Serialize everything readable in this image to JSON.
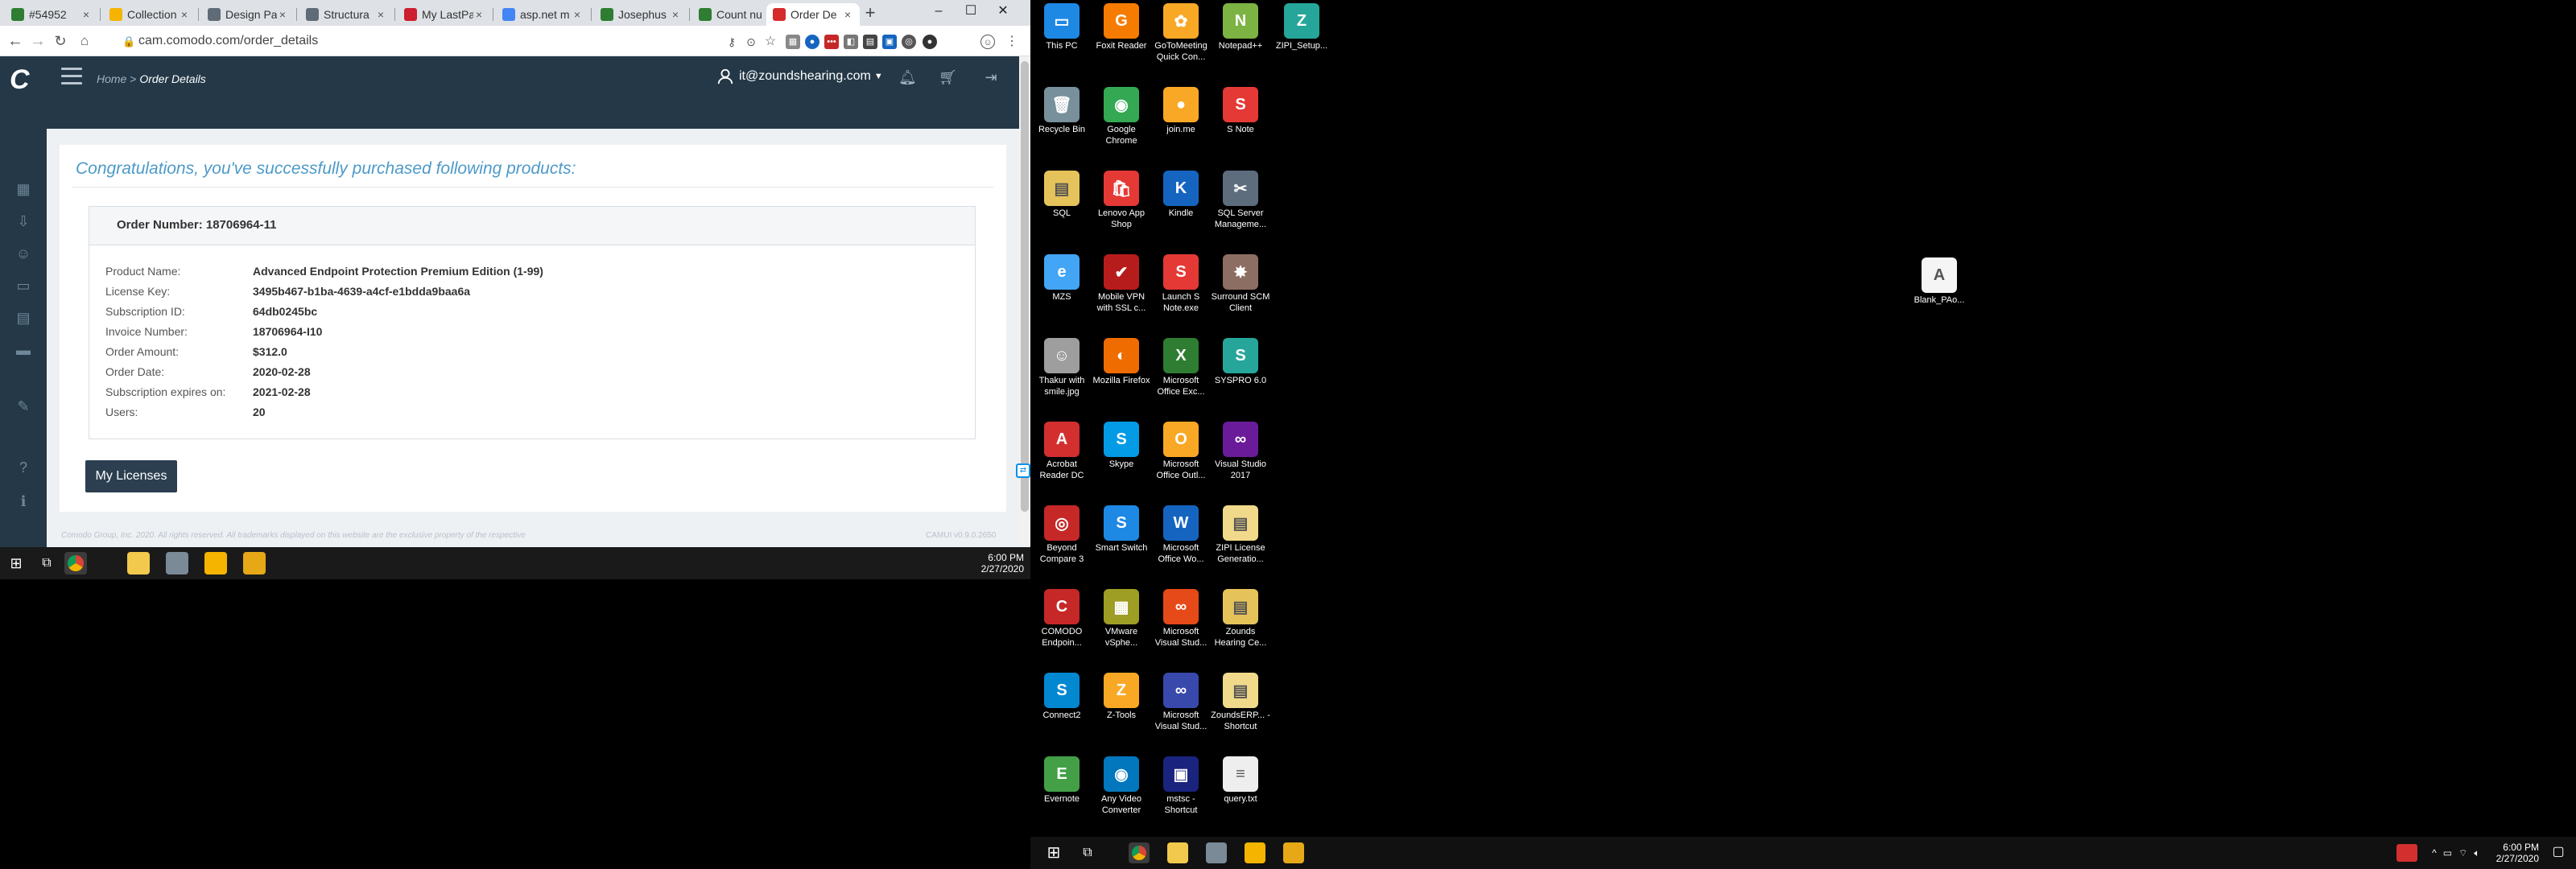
{
  "browser": {
    "tabs": [
      {
        "title": "#54952",
        "color": "#2e7d32"
      },
      {
        "title": "Collection",
        "color": "#f4b400"
      },
      {
        "title": "Design Pa",
        "color": "#5f6b76"
      },
      {
        "title": "Structura",
        "color": "#5f6b76"
      },
      {
        "title": "My LastPa",
        "color": "#cc1f2f"
      },
      {
        "title": "asp.net m",
        "color": "#4285f4"
      },
      {
        "title": "Josephus",
        "color": "#2e7d32"
      },
      {
        "title": "Count nu",
        "color": "#2e7d32"
      },
      {
        "title": "Order De",
        "color": "#d62b2b"
      }
    ],
    "url": "cam.comodo.com/order_details"
  },
  "app": {
    "logo": "C",
    "breadcrumb_home": "Home",
    "breadcrumb_sep": ">",
    "breadcrumb_current": "Order Details",
    "user_email": "it@zoundshearing.com"
  },
  "order": {
    "congrats": "Congratulations, you've successfully purchased following products:",
    "number_label": "Order Number:",
    "number": "18706964-11",
    "fields": [
      {
        "label": "Product Name:",
        "value": "Advanced Endpoint Protection Premium Edition (1-99)"
      },
      {
        "label": "License Key:",
        "value": "3495b467-b1ba-4639-a4cf-e1bdda9baa6a"
      },
      {
        "label": "Subscription ID:",
        "value": "64db0245bc"
      },
      {
        "label": "Invoice Number:",
        "value": "18706964-I10"
      },
      {
        "label": "Order Amount:",
        "value": "$312.0"
      },
      {
        "label": "Order Date:",
        "value": "2020-02-28"
      },
      {
        "label": "Subscription expires on:",
        "value": "2021-02-28"
      },
      {
        "label": "Users:",
        "value": "20"
      }
    ],
    "button": "My Licenses",
    "footer": "Comodo Group, Inc. 2020. All rights reserved. All trademarks displayed on this website are the exclusive property of the respective",
    "version": "CAMUI v0.9.0.2650"
  },
  "taskbar_left": {
    "time": "6:00 PM",
    "date": "2/27/2020"
  },
  "desktop": {
    "icons": [
      {
        "label": "This PC",
        "color": "#1e88e5",
        "glyph": "▭"
      },
      {
        "label": "Foxit Reader",
        "color": "#f57c00",
        "glyph": "G"
      },
      {
        "label": "GoToMeeting Quick Con...",
        "color": "#f9a825",
        "glyph": "✿"
      },
      {
        "label": "Notepad++",
        "color": "#7cb342",
        "glyph": "N"
      },
      {
        "label": "ZIPI_Setup...",
        "color": "#26a69a",
        "glyph": "Z"
      },
      {
        "label": "Recycle Bin",
        "color": "#78909c",
        "glyph": "🗑"
      },
      {
        "label": "Google Chrome",
        "color": "#34a853",
        "glyph": "◉"
      },
      {
        "label": "join.me",
        "color": "#f9a825",
        "glyph": "●"
      },
      {
        "label": "S Note",
        "color": "#e53935",
        "glyph": "S"
      },
      {
        "label": "SQL",
        "color": "#e6c35a",
        "glyph": "▤"
      },
      {
        "label": "Lenovo App Shop",
        "color": "#e53935",
        "glyph": "🛍"
      },
      {
        "label": "Kindle",
        "color": "#1565c0",
        "glyph": "K"
      },
      {
        "label": "SQL Server Manageme...",
        "color": "#5d6d7e",
        "glyph": "✂"
      },
      {
        "label": "MZS",
        "color": "#42a5f5",
        "glyph": "e"
      },
      {
        "label": "Mobile VPN with SSL c...",
        "color": "#b71c1c",
        "glyph": "✔"
      },
      {
        "label": "Launch S Note.exe",
        "color": "#e53935",
        "glyph": "S"
      },
      {
        "label": "Surround SCM Client",
        "color": "#8d6e63",
        "glyph": "✸"
      },
      {
        "label": "Thakur with smile.jpg",
        "color": "#9e9e9e",
        "glyph": "☺"
      },
      {
        "label": "Mozilla Firefox",
        "color": "#ef6c00",
        "glyph": "◐"
      },
      {
        "label": "Microsoft Office Exc...",
        "color": "#2e7d32",
        "glyph": "X"
      },
      {
        "label": "SYSPRO 6.0",
        "color": "#26a69a",
        "glyph": "S"
      },
      {
        "label": "Acrobat Reader DC",
        "color": "#d32f2f",
        "glyph": "A"
      },
      {
        "label": "Skype",
        "color": "#039be5",
        "glyph": "S"
      },
      {
        "label": "Microsoft Office Outl...",
        "color": "#f9a825",
        "glyph": "O"
      },
      {
        "label": "Visual Studio 2017",
        "color": "#6a1b9a",
        "glyph": "∞"
      },
      {
        "label": "Beyond Compare 3",
        "color": "#c62828",
        "glyph": "◎"
      },
      {
        "label": "Smart Switch",
        "color": "#1e88e5",
        "glyph": "S"
      },
      {
        "label": "Microsoft Office Wo...",
        "color": "#1565c0",
        "glyph": "W"
      },
      {
        "label": "ZIPI License Generatio...",
        "color": "#f0d98a",
        "glyph": "▤"
      },
      {
        "label": "COMODO Endpoin...",
        "color": "#c62828",
        "glyph": "C"
      },
      {
        "label": "VMware vSphe...",
        "color": "#9e9d24",
        "glyph": "▦"
      },
      {
        "label": "Microsoft Visual Stud...",
        "color": "#e64a19",
        "glyph": "∞"
      },
      {
        "label": "Zounds Hearing Ce...",
        "color": "#e6c35a",
        "glyph": "▤"
      },
      {
        "label": "Connect2",
        "color": "#0288d1",
        "glyph": "S"
      },
      {
        "label": "Z-Tools",
        "color": "#f9a825",
        "glyph": "Z"
      },
      {
        "label": "Microsoft Visual Stud...",
        "color": "#3949ab",
        "glyph": "∞"
      },
      {
        "label": "ZoundsERP... - Shortcut",
        "color": "#f0d98a",
        "glyph": "▤"
      },
      {
        "label": "Evernote",
        "color": "#43a047",
        "glyph": "E"
      },
      {
        "label": "Any Video Converter",
        "color": "#0277bd",
        "glyph": "◉"
      },
      {
        "label": "mstsc - Shortcut",
        "color": "#1a237e",
        "glyph": "▣"
      },
      {
        "label": "query.txt",
        "color": "#eeeeee",
        "glyph": "≡"
      },
      {
        "label": "Blank_PAo...",
        "color": "#f5f5f5",
        "glyph": "A"
      }
    ]
  },
  "taskbar_right": {
    "time": "6:00 PM",
    "date": "2/27/2020"
  }
}
